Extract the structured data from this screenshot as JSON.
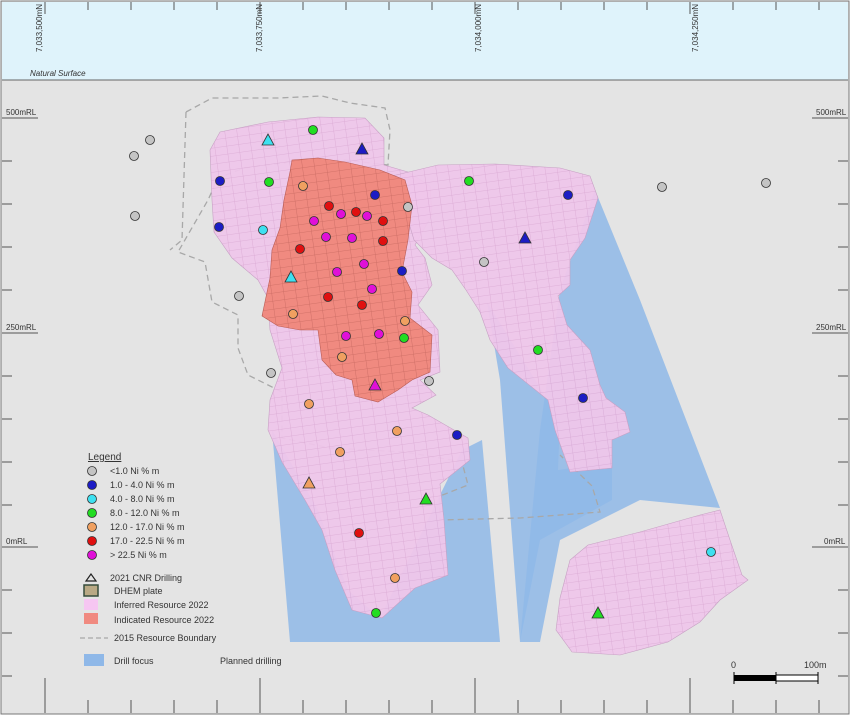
{
  "northings": [
    "7,033,500mN",
    "7,033,750mN",
    "7,034,000mN",
    "7,034,250mN"
  ],
  "surface_label": "Natural Surface",
  "rl_labels": {
    "rl500": "500mRL",
    "rl250": "250mRL",
    "rl0": "0mRL"
  },
  "legend": {
    "title": "Legend",
    "grade_items": [
      {
        "label": "<1.0 Ni % m",
        "color": "#c4c4c4"
      },
      {
        "label": "1.0 - 4.0 Ni % m",
        "color": "#1c1cc4"
      },
      {
        "label": "4.0 - 8.0 Ni % m",
        "color": "#3ee0f0"
      },
      {
        "label": "8.0 - 12.0 Ni % m",
        "color": "#22dd22"
      },
      {
        "label": "12.0 - 17.0 Ni % m",
        "color": "#f0a060"
      },
      {
        "label": "17.0 - 22.5 Ni % m",
        "color": "#e01010"
      },
      {
        "label": "> 22.5 Ni % m",
        "color": "#e010d8"
      }
    ],
    "drilling_label": "2021 CNR Drilling",
    "dhem_label": "DHEM plate",
    "inferred_label": "Inferred Resource 2022",
    "indicated_label": "Indicated Resource 2022",
    "boundary_label": "2015 Resource Boundary",
    "drill_focus_label": "Drill focus",
    "planned_label": "Planned drilling"
  },
  "colors": {
    "sky": "#dff3fb",
    "background": "#e4e4e4",
    "inferred": "#efc6ea",
    "indicated": "#f08a80",
    "drill_focus": "#8fb8e8",
    "boundary": "#a8a8a8"
  },
  "scale_bar": {
    "start_label": "0",
    "end_label": "100m"
  },
  "drillholes": [
    {
      "grade": "<1.0 Ni % m",
      "type": "circle"
    },
    {
      "grade": "<1.0 Ni % m",
      "type": "circle"
    },
    {
      "grade": "<1.0 Ni % m",
      "type": "circle"
    },
    {
      "grade": "<1.0 Ni % m",
      "type": "circle"
    },
    {
      "grade": "<1.0 Ni % m",
      "type": "circle"
    },
    {
      "grade": "<1.0 Ni % m",
      "type": "circle"
    },
    {
      "grade": "<1.0 Ni % m",
      "type": "circle"
    },
    {
      "grade": "<1.0 Ni % m",
      "type": "circle"
    },
    {
      "grade": "<1.0 Ni % m",
      "type": "circle"
    },
    {
      "grade": "<1.0 Ni % m",
      "type": "circle"
    },
    {
      "grade": "1.0 - 4.0 Ni % m",
      "type": "circle"
    },
    {
      "grade": "1.0 - 4.0 Ni % m",
      "type": "circle"
    },
    {
      "grade": "1.0 - 4.0 Ni % m",
      "type": "circle"
    },
    {
      "grade": "1.0 - 4.0 Ni % m",
      "type": "circle"
    },
    {
      "grade": "1.0 - 4.0 Ni % m",
      "type": "circle"
    },
    {
      "grade": "1.0 - 4.0 Ni % m",
      "type": "circle"
    },
    {
      "grade": "1.0 - 4.0 Ni % m",
      "type": "circle"
    },
    {
      "grade": "1.0 - 4.0 Ni % m",
      "type": "triangle"
    },
    {
      "grade": "1.0 - 4.0 Ni % m",
      "type": "triangle"
    },
    {
      "grade": "4.0 - 8.0 Ni % m",
      "type": "circle"
    },
    {
      "grade": "4.0 - 8.0 Ni % m",
      "type": "circle"
    },
    {
      "grade": "4.0 - 8.0 Ni % m",
      "type": "triangle"
    },
    {
      "grade": "4.0 - 8.0 Ni % m",
      "type": "triangle"
    },
    {
      "grade": "8.0 - 12.0 Ni % m",
      "type": "circle"
    },
    {
      "grade": "8.0 - 12.0 Ni % m",
      "type": "circle"
    },
    {
      "grade": "8.0 - 12.0 Ni % m",
      "type": "circle"
    },
    {
      "grade": "8.0 - 12.0 Ni % m",
      "type": "circle"
    },
    {
      "grade": "8.0 - 12.0 Ni % m",
      "type": "circle"
    },
    {
      "grade": "8.0 - 12.0 Ni % m",
      "type": "circle"
    },
    {
      "grade": "8.0 - 12.0 Ni % m",
      "type": "triangle"
    },
    {
      "grade": "8.0 - 12.0 Ni % m",
      "type": "triangle"
    },
    {
      "grade": "12.0 - 17.0 Ni % m",
      "type": "circle"
    },
    {
      "grade": "12.0 - 17.0 Ni % m",
      "type": "circle"
    },
    {
      "grade": "12.0 - 17.0 Ni % m",
      "type": "circle"
    },
    {
      "grade": "12.0 - 17.0 Ni % m",
      "type": "circle"
    },
    {
      "grade": "12.0 - 17.0 Ni % m",
      "type": "circle"
    },
    {
      "grade": "12.0 - 17.0 Ni % m",
      "type": "circle"
    },
    {
      "grade": "12.0 - 17.0 Ni % m",
      "type": "circle"
    },
    {
      "grade": "12.0 - 17.0 Ni % m",
      "type": "circle"
    },
    {
      "grade": "12.0 - 17.0 Ni % m",
      "type": "triangle"
    },
    {
      "grade": "17.0 - 22.5 Ni % m",
      "type": "circle"
    },
    {
      "grade": "17.0 - 22.5 Ni % m",
      "type": "circle"
    },
    {
      "grade": "17.0 - 22.5 Ni % m",
      "type": "circle"
    },
    {
      "grade": "17.0 - 22.5 Ni % m",
      "type": "circle"
    },
    {
      "grade": "17.0 - 22.5 Ni % m",
      "type": "circle"
    },
    {
      "grade": "17.0 - 22.5 Ni % m",
      "type": "circle"
    },
    {
      "grade": "17.0 - 22.5 Ni % m",
      "type": "circle"
    },
    {
      "grade": "17.0 - 22.5 Ni % m",
      "type": "circle"
    },
    {
      "grade": "> 22.5 Ni % m",
      "type": "circle"
    },
    {
      "grade": "> 22.5 Ni % m",
      "type": "circle"
    },
    {
      "grade": "> 22.5 Ni % m",
      "type": "circle"
    },
    {
      "grade": "> 22.5 Ni % m",
      "type": "circle"
    },
    {
      "grade": "> 22.5 Ni % m",
      "type": "circle"
    },
    {
      "grade": "> 22.5 Ni % m",
      "type": "circle"
    },
    {
      "grade": "> 22.5 Ni % m",
      "type": "circle"
    },
    {
      "grade": "> 22.5 Ni % m",
      "type": "circle"
    },
    {
      "grade": "> 22.5 Ni % m",
      "type": "circle"
    },
    {
      "grade": "> 22.5 Ni % m",
      "type": "circle"
    },
    {
      "grade": "> 22.5 Ni % m",
      "type": "triangle"
    }
  ]
}
